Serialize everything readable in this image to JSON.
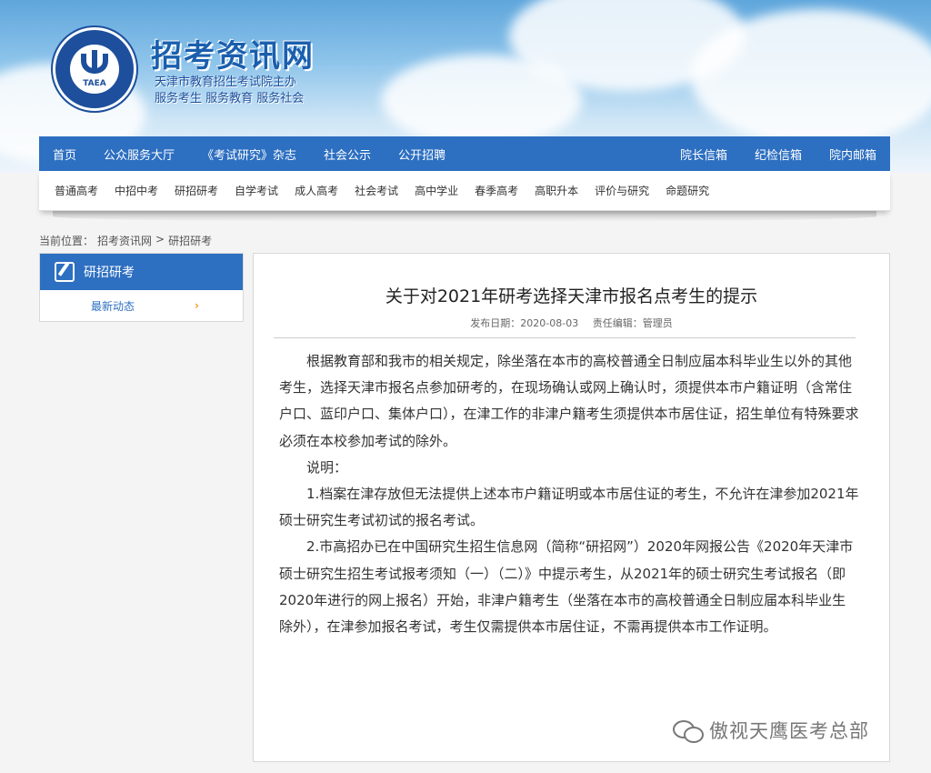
{
  "header": {
    "site_title": "招考资讯网",
    "subtitle_line1": "天津市教育招生考试院主办",
    "subtitle_line2": "服务考生 服务教育 服务社会",
    "logo_text": "TAEA"
  },
  "nav": {
    "left": [
      "首页",
      "公众服务大厅",
      "《考试研究》杂志",
      "社会公示",
      "公开招聘"
    ],
    "right": [
      "院长信箱",
      "纪检信箱",
      "院内邮箱"
    ]
  },
  "subnav": [
    "普通高考",
    "中招中考",
    "研招研考",
    "自学考试",
    "成人高考",
    "社会考试",
    "高中学业",
    "春季高考",
    "高职升本",
    "评价与研究",
    "命题研究"
  ],
  "breadcrumb": {
    "prefix": "当前位置：",
    "items": [
      "招考资讯网",
      "研招研考"
    ],
    "separator": ">"
  },
  "sidebar": {
    "title": "研招研考",
    "items": [
      {
        "label": "最新动态",
        "arrow": "›"
      }
    ]
  },
  "article": {
    "title": "关于对2021年研考选择天津市报名点考生的提示",
    "date_label": "发布日期：2020-08-03",
    "editor_label": "责任编辑：管理员",
    "paragraphs": [
      "根据教育部和我市的相关规定，除坐落在本市的高校普通全日制应届本科毕业生以外的其他考生，选择天津市报名点参加研考的，在现场确认或网上确认时，须提供本市户籍证明（含常住户口、蓝印户口、集体户口），在津工作的非津户籍考生须提供本市居住证，招生单位有特殊要求必须在本校参加考试的除外。",
      "说明：",
      "1.档案在津存放但无法提供上述本市户籍证明或本市居住证的考生，不允许在津参加2021年硕士研究生考试初试的报名考试。",
      "2.市高招办已在中国研究生招生信息网（简称“研招网”）2020年网报公告《2020年天津市硕士研究生招生考试报考须知（一）（二）》中提示考生，从2021年的硕士研究生考试报名（即2020年进行的网上报名）开始，非津户籍考生（坐落在本市的高校普通全日制应届本科毕业生除外），在津参加报名考试，考生仅需提供本市居住证，不需再提供本市工作证明。"
    ]
  },
  "watermark": {
    "text": "傲视天鹰医考总部",
    "icon": "wechat-icon"
  },
  "colors": {
    "nav_blue": "#2d6fc1",
    "title_blue": "#1a5fae",
    "arrow_orange": "#f39c12"
  }
}
